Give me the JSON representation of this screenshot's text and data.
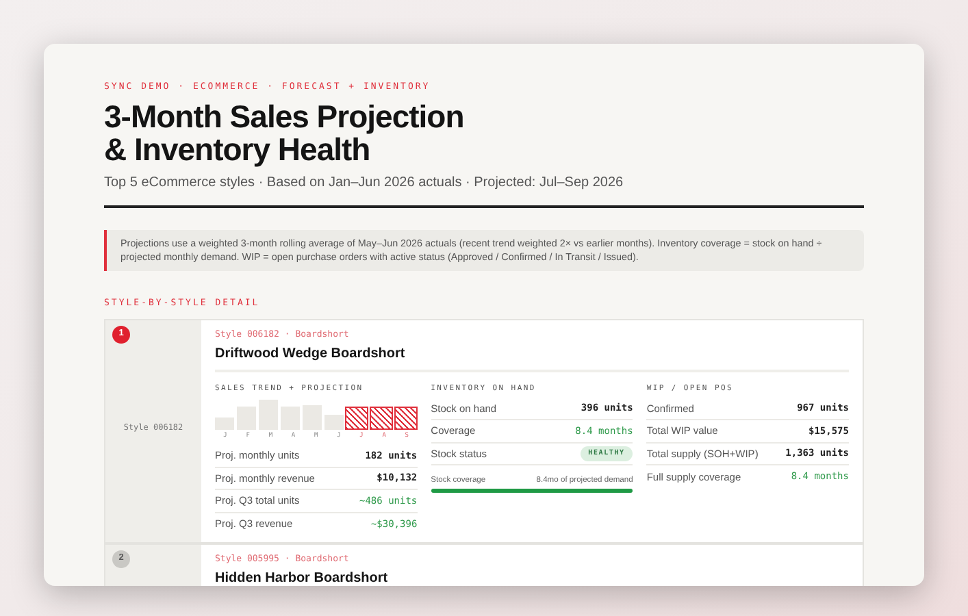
{
  "eyebrow": "SYNC DEMO · ECOMMERCE · FORECAST + INVENTORY",
  "title_lines": [
    "3-Month Sales Projection",
    "& Inventory Health"
  ],
  "subtitle": "Top 5 eCommerce styles · Based on Jan–Jun 2026 actuals · Projected: Jul–Sep 2026",
  "note": "Projections use a weighted 3-month rolling average of May–Jun 2026 actuals (recent trend weighted 2× vs earlier months). Inventory coverage = stock on hand ÷ projected monthly demand. WIP = open purchase orders with active status (Approved / Confirmed / In Transit / Issued).",
  "section_label": "STYLE-BY-STYLE DETAIL",
  "styles": [
    {
      "rank": "1",
      "selected": true,
      "side_label": "Style 006182",
      "style_line": "Style 006182 · Boardshort",
      "name": "Driftwood Wedge Boardshort",
      "sales_trend": {
        "title": "SALES TREND + PROJECTION",
        "months": [
          {
            "label": "J",
            "kind": "actual"
          },
          {
            "label": "F",
            "kind": "actual"
          },
          {
            "label": "M",
            "kind": "actual"
          },
          {
            "label": "A",
            "kind": "actual"
          },
          {
            "label": "M",
            "kind": "actual"
          },
          {
            "label": "J",
            "kind": "actual"
          },
          {
            "label": "J",
            "kind": "projected"
          },
          {
            "label": "A",
            "kind": "projected"
          },
          {
            "label": "S",
            "kind": "projected"
          }
        ],
        "rows": [
          {
            "label": "Proj. monthly units",
            "value": "182 units",
            "positive": false
          },
          {
            "label": "Proj. monthly revenue",
            "value": "$10,132",
            "positive": false
          },
          {
            "label": "Proj. Q3 total units",
            "value": "~486 units",
            "positive": true
          },
          {
            "label": "Proj. Q3 revenue",
            "value": "~$30,396",
            "positive": true
          }
        ]
      },
      "inventory": {
        "title": "INVENTORY ON HAND",
        "rows": [
          {
            "label": "Stock on hand",
            "value": "396 units",
            "kind": "text",
            "positive": false
          },
          {
            "label": "Coverage",
            "value": "8.4 months",
            "kind": "text",
            "positive": true
          },
          {
            "label": "Stock status",
            "value": "HEALTHY",
            "kind": "badge",
            "positive": true
          }
        ],
        "coverage_bar": {
          "label": "Stock coverage",
          "reading": "8.4mo of projected demand",
          "level": 1
        }
      },
      "wip": {
        "title": "WIP / OPEN POS",
        "rows": [
          {
            "label": "Confirmed",
            "value": "967 units",
            "positive": false
          },
          {
            "label": "Total WIP value",
            "value": "$15,575",
            "positive": false
          },
          {
            "label": "Total supply (SOH+WIP)",
            "value": "1,363 units",
            "positive": false
          },
          {
            "label": "Full supply coverage",
            "value": "8.4 months",
            "positive": true
          }
        ]
      }
    },
    {
      "rank": "2",
      "selected": false,
      "style_line": "Style 005995 · Boardshort",
      "name": "Hidden Harbor Boardshort"
    }
  ]
}
